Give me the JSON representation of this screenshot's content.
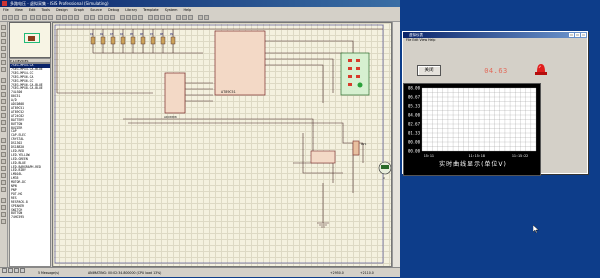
{
  "window_title": "多路电压 - 虚拟采集 - ISIS Professional (Simulating)",
  "menu": [
    "File",
    "View",
    "Edit",
    "Tools",
    "Design",
    "Graph",
    "Source",
    "Debug",
    "Library",
    "Template",
    "System",
    "Help"
  ],
  "device_list_header": "P  L  DEVICES",
  "devices": [
    "7SEG-MPX4-CA",
    "7SEG-MPX4-CA-BLUE",
    "7SEG-MPX4-CC",
    "7SEG-MPX6-CA",
    "7SEG-MPX6-CC",
    "7SEG-MPX6-CA-BLUE",
    "7SEG-MPX8-CA-BLUE",
    "74LS00",
    "80C51",
    "A/D",
    "ADC0808",
    "AT89C51",
    "AT89C52",
    "AT24C02",
    "BATTERY",
    "BUTTON",
    "BUZZER",
    "CAP",
    "CAP-ELEC",
    "CRYSTAL",
    "DS1302",
    "DS18B20",
    "LED-RED",
    "LED-YELLOW",
    "LED-GREEN",
    "LED-BLUE",
    "LED-BARGRAPH-RED",
    "LED-BIBY",
    "LM016L",
    "LM35",
    "MOTOR-DC",
    "NPN",
    "PNP",
    "POT-HG",
    "RES",
    "RESPACK-8",
    "SPEAKER",
    "SWITCH",
    "BUTTON",
    "74HC595"
  ],
  "selected_device_index": 0,
  "status": {
    "messages": "5 Message(s)",
    "animating": "ANIMATING: 00:02:34.800000 (CPU load 13%)",
    "coord_x": "+2950.0",
    "coord_y": "+2110.0"
  },
  "schematic": {
    "chip_label": "AT89C51",
    "adc_label": "ADC0808",
    "resistor_labels": [
      "R1",
      "R2",
      "R3",
      "R4",
      "R5",
      "R6",
      "R7",
      "R8",
      "R9"
    ],
    "meter_label": "U",
    "pot_label": "RV1"
  },
  "vwin": {
    "title": "虚拟仪表",
    "menu": "File  Edit  View  Help",
    "close_label": "关闭",
    "reading": "04.63",
    "lamp_icon": "red-alarm-lamp",
    "chart_title": "实时曲线显示(单位V)"
  },
  "chart_data": {
    "type": "line",
    "y_ticks": [
      "08.00",
      "06.67",
      "05.33",
      "04.00",
      "02.67",
      "01.33",
      "00.00",
      "00.00"
    ],
    "x_ticks": [
      "15:11",
      "11:15:18",
      "11:15:22"
    ],
    "ylim": [
      0,
      8
    ],
    "grid": true,
    "series": [
      {
        "values": []
      }
    ]
  },
  "colors": {
    "desktop": "#0d3d8a",
    "reading": "#e36a5a",
    "chart_bg": "#ffffff",
    "grid": "#a5a5a5",
    "wire": "#4a2a2a"
  }
}
